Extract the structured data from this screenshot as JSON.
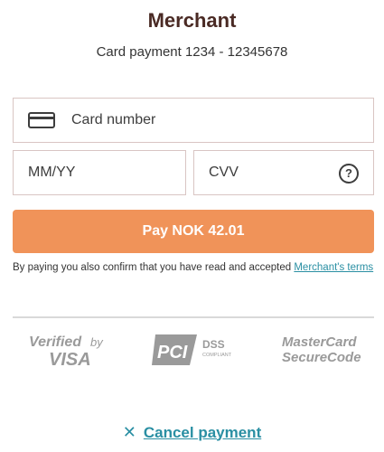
{
  "header": {
    "merchant_name": "Merchant",
    "payment_reference": "Card payment 1234 - 12345678"
  },
  "form": {
    "card_number_placeholder": "Card number",
    "expiry_placeholder": "MM/YY",
    "cvv_placeholder": "CVV",
    "help_symbol": "?"
  },
  "pay_button": {
    "label": "Pay NOK 42.01"
  },
  "terms": {
    "text": "By paying you also confirm that you have read and accepted ",
    "link_text": "Merchant's terms"
  },
  "badges": {
    "verified_by_visa": [
      "Verified",
      "by",
      "VISA"
    ],
    "pci_dss": [
      "PCI",
      "DSS",
      "COMPLIANT"
    ],
    "mastercard_securecode": [
      "MasterCard",
      "SecureCode"
    ]
  },
  "cancel": {
    "icon": "close-icon",
    "label": "Cancel payment"
  },
  "colors": {
    "brand_text": "#4a2a24",
    "pay_button": "#f09359",
    "link": "#2a8fa3",
    "field_border": "#d9c5c3",
    "badge_gray": "#9a9a9a"
  }
}
